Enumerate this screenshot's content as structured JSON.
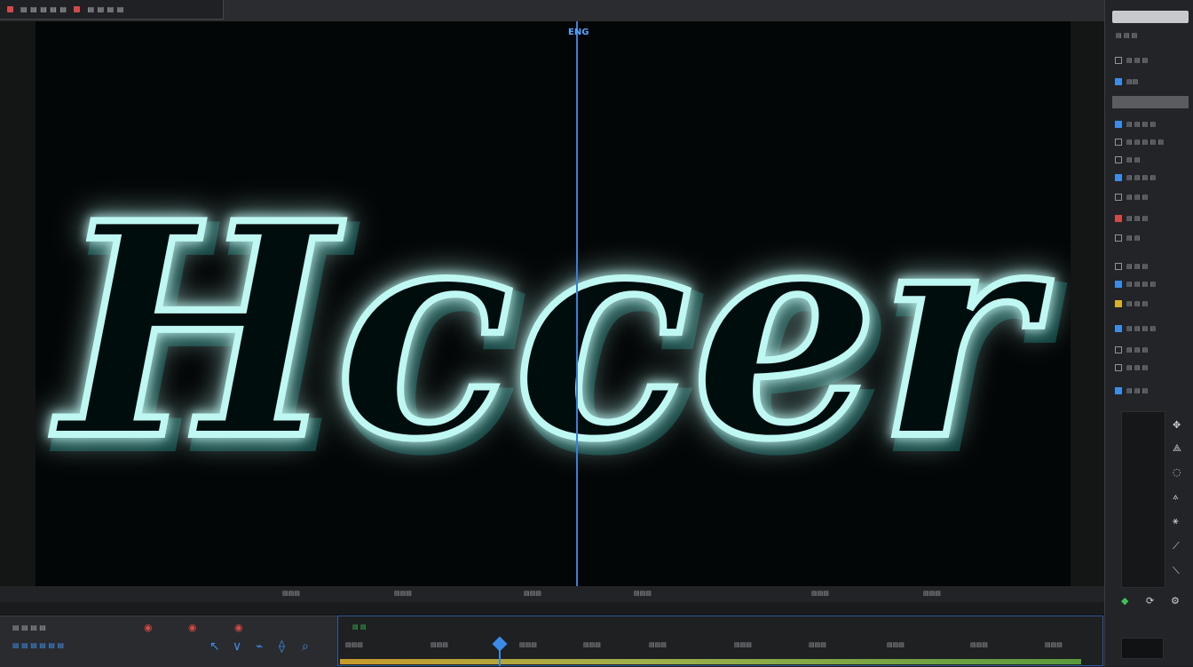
{
  "top_bar": {
    "menu_text_1": "▤ ▤ ▤ ▤ ▤",
    "menu_text_2": "▤ ▤ ▤ ▤"
  },
  "viewer": {
    "playhead_label": "ENG",
    "neon_text": "Hccer",
    "neon_color": "#bff8f3",
    "glow_color": "#1fd6c8"
  },
  "right_panel": {
    "header_label": "▤ ▤ ▤",
    "items": [
      {
        "label": "▤ ▤ ▤",
        "icon": "folder-icon"
      },
      {
        "label": "▤▤",
        "icon": "media-icon"
      },
      {
        "label": "▤ ▤ ▤ ▤",
        "icon": "list-icon"
      },
      {
        "label": "▤ ▤ ▤ ▤ ▤",
        "icon": "section-icon"
      },
      {
        "label": "▤ ▤",
        "icon": "square-icon"
      },
      {
        "label": "▤ ▤ ▤ ▤",
        "icon": "image-icon"
      },
      {
        "label": "▤ ▤ ▤",
        "icon": "layer-icon"
      },
      {
        "label": "▤ ▤ ▤",
        "icon": "red-layer-icon"
      },
      {
        "label": "▤ ▤",
        "icon": "divider-label"
      },
      {
        "label": "▤ ▤ ▤",
        "icon": "pen-icon"
      },
      {
        "label": "▤ ▤ ▤ ▤",
        "icon": "photo-icon"
      },
      {
        "label": "▤ ▤ ▤",
        "icon": "yellow-box-icon"
      },
      {
        "label": "▤ ▤ ▤ ▤",
        "icon": "edit-icon"
      },
      {
        "label": "▤ ▤ ▤",
        "icon": "clock-icon"
      },
      {
        "label": "▤ ▤ ▤",
        "icon": "properties-icon"
      },
      {
        "label": "▤ ▤ ▤",
        "icon": "effects-icon"
      }
    ]
  },
  "timeline": {
    "toolbar_ticks": [
      "▤▤▤",
      "▤▤▤",
      "▤▤▤",
      "▤▤▤",
      "▤▤▤",
      "▤▤▤"
    ],
    "track_label": "▤ ▤",
    "track_ticks": [
      "▤▤▤",
      "▤▤▤",
      "▤▤▤",
      "▤▤▤",
      "▤▤▤",
      "▤▤▤",
      "▤▤▤",
      "▤▤▤",
      "▤▤▤",
      "▤▤▤"
    ],
    "left_panel_label": "▤ ▤ ▤ ▤",
    "left_panel_label2": "▤ ▤ ▤ ▤ ▤ ▤"
  }
}
